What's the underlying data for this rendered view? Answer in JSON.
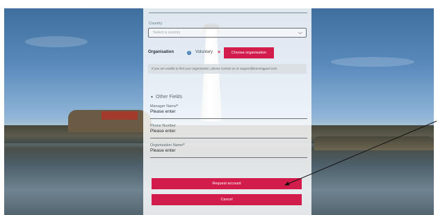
{
  "form": {
    "country_label": "Country",
    "country_placeholder": "Select a country",
    "organisation_label": "Organisation",
    "organisation_value": "Voluntary",
    "choose_organisation_button": "Choose organisation",
    "org_note": "If you are unable to find your organisation, please contact us at support@learningpool.com",
    "other_fields_toggle": "Other Fields",
    "fields": [
      {
        "label": "Manager Name",
        "required": true,
        "placeholder": "Please enter"
      },
      {
        "label": "Phone Number",
        "required": false,
        "placeholder": "Please enter"
      },
      {
        "label": "Organisation Name",
        "required": true,
        "placeholder": "Please enter"
      }
    ],
    "request_account_button": "Request account",
    "cancel_button": "Cancel"
  },
  "icons": {
    "info": "info-icon",
    "remove": "close-icon",
    "dropdown": "chevron-down-icon",
    "toggle": "triangle-down-icon"
  },
  "colors": {
    "accent": "#d21c4c",
    "info": "#3f7ab8"
  }
}
